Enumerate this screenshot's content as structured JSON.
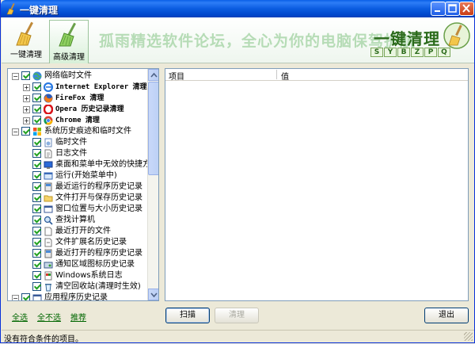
{
  "window": {
    "title": "一键清理"
  },
  "tabs": [
    {
      "label": "一键清理"
    },
    {
      "label": "高级清理"
    }
  ],
  "banner": {
    "slogan": "孤雨精选软件论坛，全心为你的电脑保驾护航",
    "logo_title": "一键清理",
    "logo_letters": [
      "S",
      "Y",
      "B",
      "Z",
      "P",
      "Q"
    ]
  },
  "tree": {
    "items": [
      {
        "label": "网络临时文件"
      },
      {
        "label": "Internet Explorer 清理"
      },
      {
        "label": "FireFox 清理"
      },
      {
        "label": "Opera 历史记录清理"
      },
      {
        "label": "Chrome 清理"
      },
      {
        "label": "系统历史痕迹和临时文件"
      },
      {
        "label": "临时文件"
      },
      {
        "label": "日志文件"
      },
      {
        "label": "桌面和菜单中无效的快捷方式"
      },
      {
        "label": "运行(开始菜单中)"
      },
      {
        "label": "最近运行的程序历史记录"
      },
      {
        "label": "文件打开与保存历史记录"
      },
      {
        "label": "窗口位置与大小历史记录"
      },
      {
        "label": "查找计算机"
      },
      {
        "label": "最近打开的文件"
      },
      {
        "label": "文件扩展名历史记录"
      },
      {
        "label": "最近打开的程序历史记录"
      },
      {
        "label": "通知区域图标历史记录"
      },
      {
        "label": "Windows系统日志"
      },
      {
        "label": "清空回收站(清理时生效)"
      },
      {
        "label": "应用程序历史记录"
      }
    ]
  },
  "links": {
    "select_all": "全选",
    "select_none": "全不选",
    "recommend": "推荐"
  },
  "results": {
    "col_item": "项目",
    "col_value": "值"
  },
  "buttons": {
    "scan": "扫描",
    "clean": "清理",
    "exit": "退出"
  },
  "status": {
    "text": "没有符合条件的项目。"
  }
}
